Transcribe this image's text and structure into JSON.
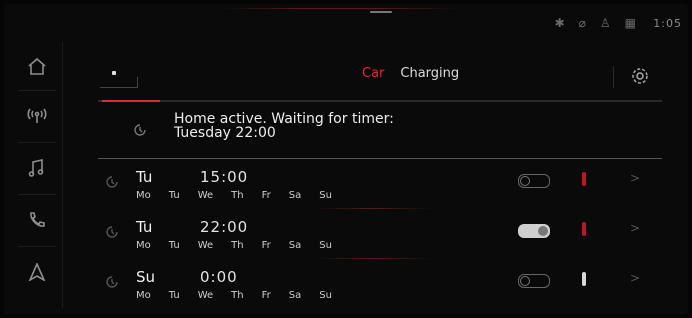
{
  "status": {
    "time": "1:05",
    "icons": [
      "bluetooth-icon",
      "mute-icon",
      "seatbelt-icon",
      "signal-icon"
    ]
  },
  "sidebar": {
    "items": [
      "home-icon",
      "radio-icon",
      "music-icon",
      "phone-icon",
      "navigation-icon"
    ]
  },
  "tabs": {
    "car": "Car",
    "charging": "Charging"
  },
  "home": {
    "line1": "Home active. Waiting for timer:",
    "line2": "Tuesday 22:00"
  },
  "timers": [
    {
      "day": "Tu",
      "time": "15:00",
      "weekdays": [
        "Mo",
        "Tu",
        "We",
        "Th",
        "Fr",
        "Sa",
        "Su"
      ],
      "enabled": false,
      "thermo_color": "#c0152a"
    },
    {
      "day": "Tu",
      "time": "22:00",
      "weekdays": [
        "Mo",
        "Tu",
        "We",
        "Th",
        "Fr",
        "Sa",
        "Su"
      ],
      "enabled": true,
      "thermo_color": "#c0152a"
    },
    {
      "day": "Su",
      "time": "0:00",
      "weekdays": [
        "Mo",
        "Tu",
        "We",
        "Th",
        "Fr",
        "Sa",
        "Su"
      ],
      "enabled": false,
      "thermo_color": "#d8d8d8"
    }
  ],
  "colors": {
    "accent": "#e0283a",
    "text": "#ededed"
  }
}
